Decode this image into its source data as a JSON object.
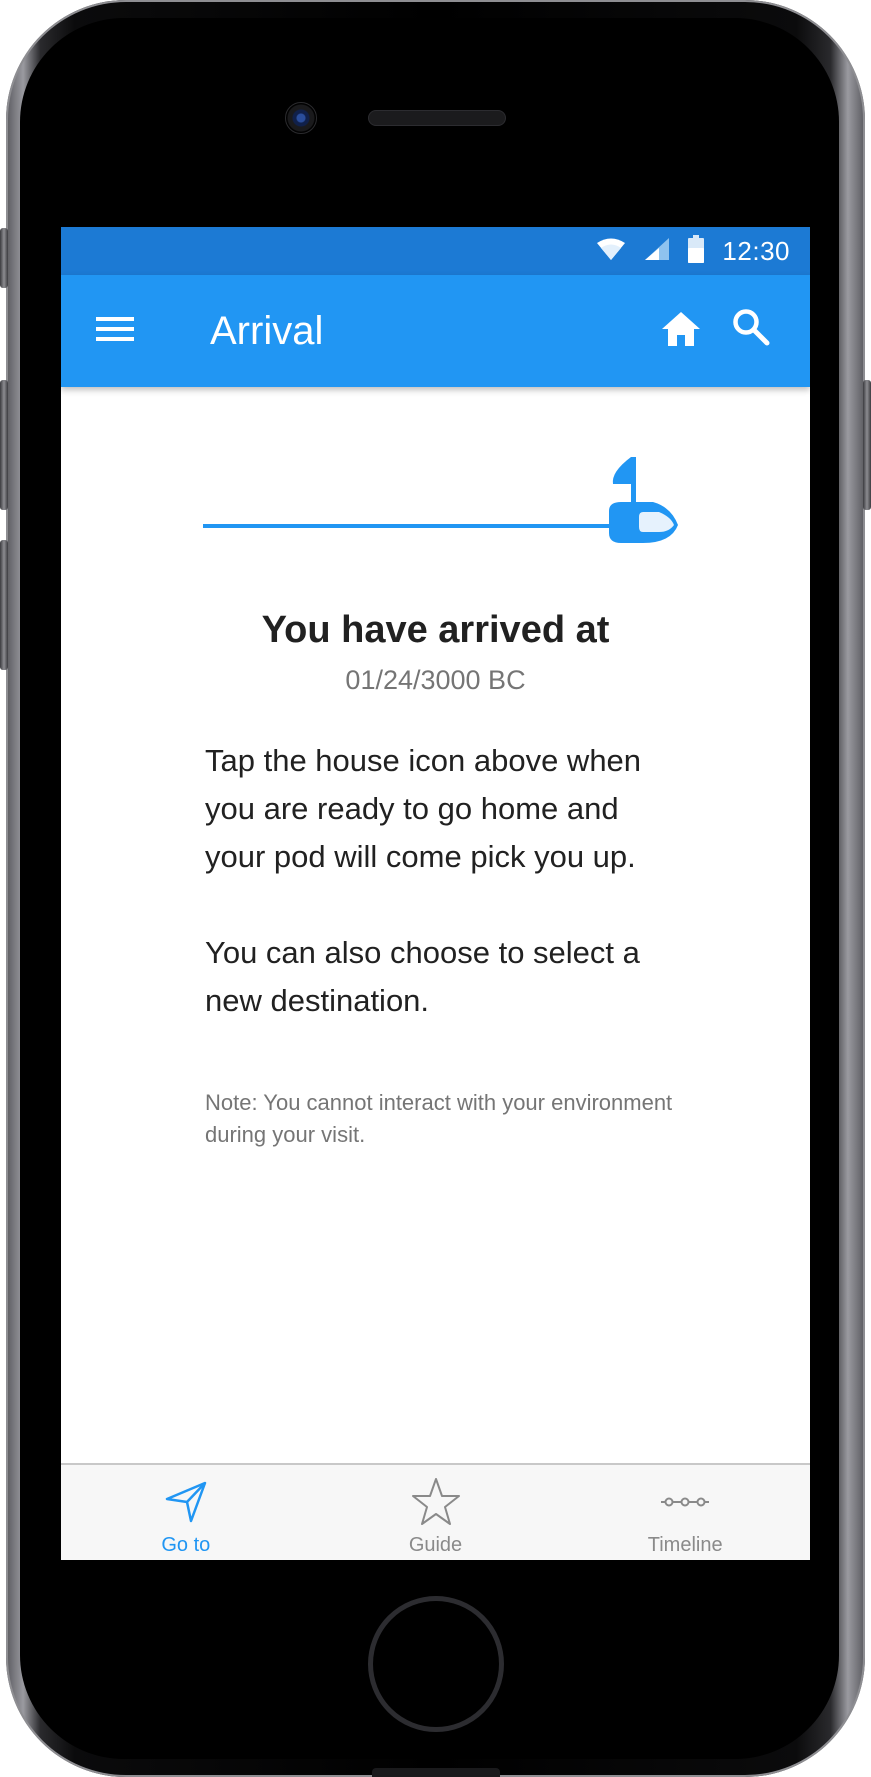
{
  "status_bar": {
    "time": "12:30",
    "wifi_icon": "wifi-icon",
    "signal_icon": "signal-icon",
    "battery_icon": "battery-icon"
  },
  "app_bar": {
    "title": "Arrival",
    "menu_icon": "hamburger-menu-icon",
    "home_icon": "house-icon",
    "search_icon": "search-icon",
    "color": "#2196f3"
  },
  "main": {
    "graphic_icon": "pod-with-flag-icon",
    "headline": "You have arrived at",
    "date": "01/24/3000 BC",
    "paragraph_1": "Tap the house icon above when you are ready to go home and your pod will come pick you up.",
    "paragraph_2": "You can also choose to select a new destination.",
    "note": "Note: You cannot interact with your environment during your visit."
  },
  "bottom_nav": {
    "items": [
      {
        "label": "Go to",
        "icon": "navigation-arrow-icon",
        "active": true
      },
      {
        "label": "Guide",
        "icon": "star-icon",
        "active": false
      },
      {
        "label": "Timeline",
        "icon": "timeline-icon",
        "active": false
      }
    ],
    "active_color": "#2196f3",
    "inactive_color": "#8a8a8a"
  }
}
